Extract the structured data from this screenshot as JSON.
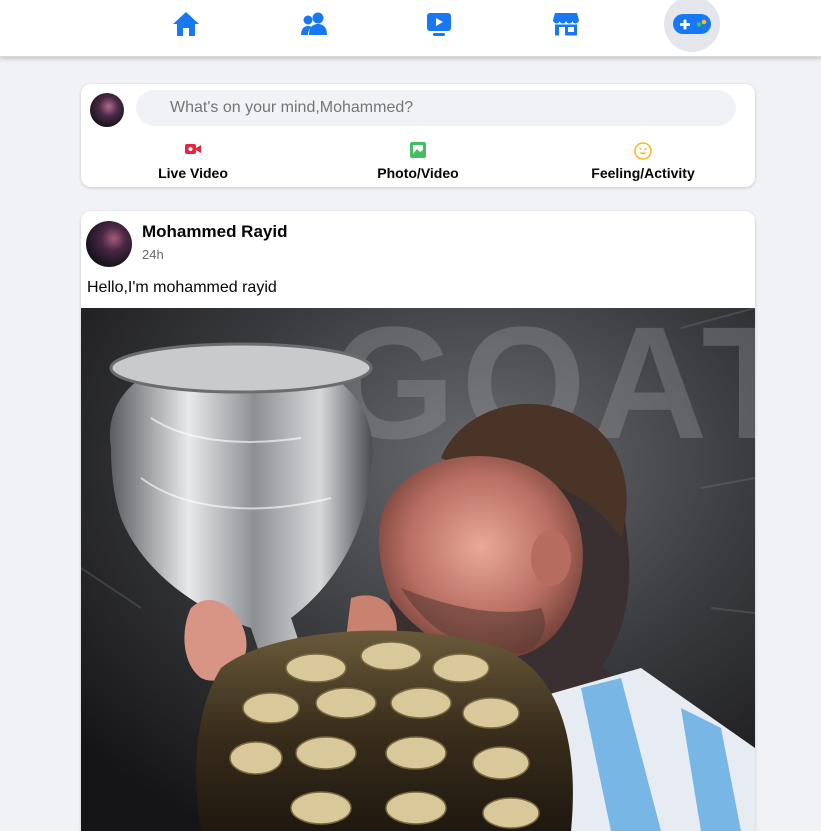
{
  "nav": {
    "items": [
      {
        "name": "home",
        "icon": "home-icon"
      },
      {
        "name": "friends",
        "icon": "friends-icon"
      },
      {
        "name": "watch",
        "icon": "video-icon"
      },
      {
        "name": "marketplace",
        "icon": "store-icon"
      },
      {
        "name": "gaming",
        "icon": "gamepad-icon",
        "active": true
      }
    ],
    "accent": "#1877f2"
  },
  "composer": {
    "placeholder": "What's on your mind,Mohammed?",
    "actions": [
      {
        "label": "Live Video",
        "icon": "live-video-icon",
        "color": "#e42645"
      },
      {
        "label": "Photo/Video",
        "icon": "photo-icon",
        "color": "#45bd62"
      },
      {
        "label": "Feeling/Activity",
        "icon": "smile-icon",
        "color": "#f7b928"
      }
    ]
  },
  "post": {
    "author": "Mohammed Rayid",
    "time": "24h",
    "text": "Hello,I'm mohammed rayid",
    "image_overlay_text": "GOAT"
  }
}
